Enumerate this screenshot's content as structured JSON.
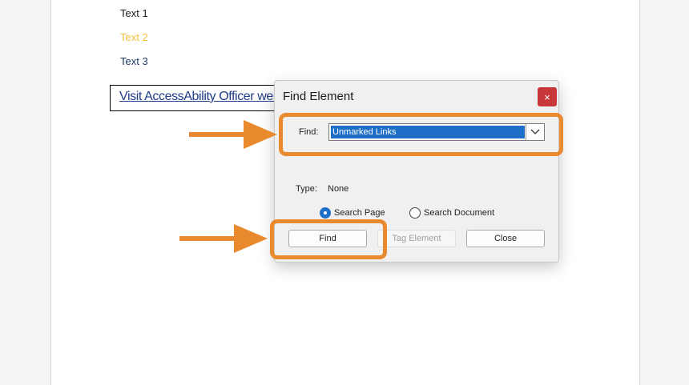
{
  "document": {
    "lines": [
      "Text 1",
      "Text 2",
      "Text 3"
    ],
    "link_text": "Visit AccessAbility Officer website"
  },
  "dialog": {
    "title": "Find Element",
    "close_glyph": "×",
    "find_label": "Find:",
    "find_value": "Unmarked Links",
    "type_label": "Type:",
    "type_value": "None",
    "radios": [
      {
        "label": "Search Page",
        "selected": true
      },
      {
        "label": "Search Document",
        "selected": false
      }
    ],
    "buttons": {
      "find": "Find",
      "tag": "Tag Element",
      "close": "Close"
    }
  },
  "annotations": {
    "highlight_color": "#e98a2e",
    "arrow_icon": "arrow-right-icon"
  }
}
